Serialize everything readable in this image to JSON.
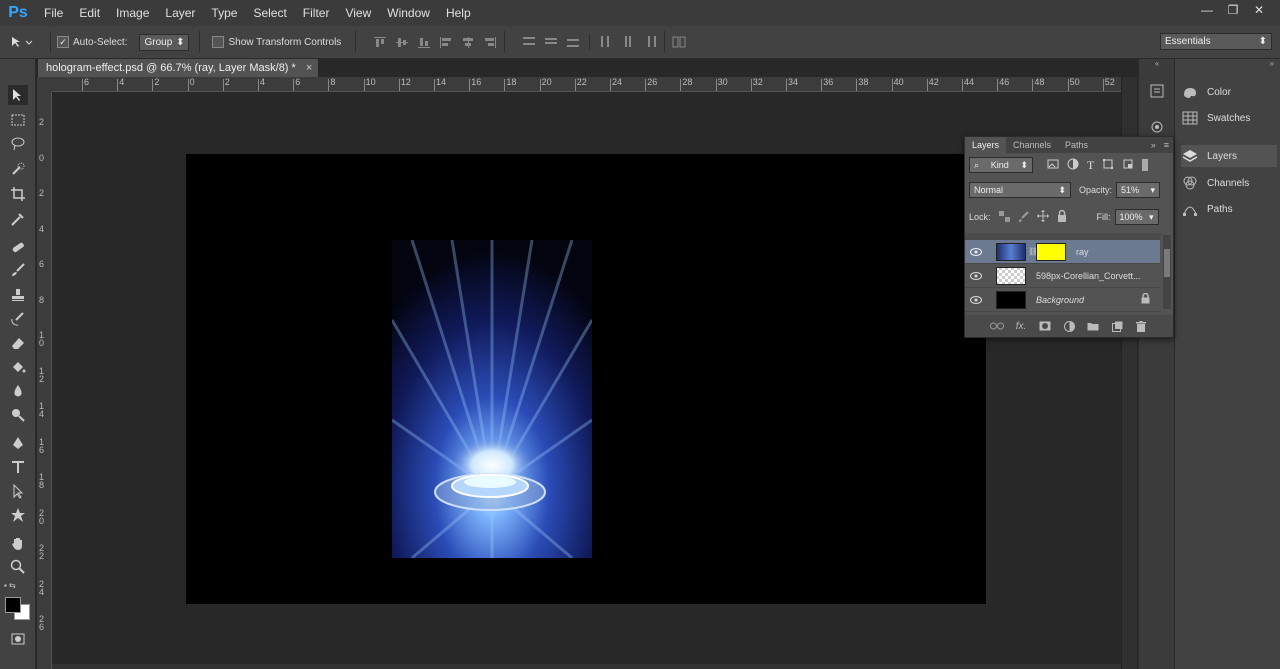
{
  "app": {
    "logo": "Ps"
  },
  "menu": [
    "File",
    "Edit",
    "Image",
    "Layer",
    "Type",
    "Select",
    "Filter",
    "View",
    "Window",
    "Help"
  ],
  "window_controls": {
    "minimize": "—",
    "restore": "❐",
    "close": "✕"
  },
  "options": {
    "auto_select_label": "Auto-Select:",
    "auto_select_checked": true,
    "auto_select_target": "Group",
    "transform_controls_label": "Show Transform Controls",
    "transform_controls_checked": false,
    "workspace": "Essentials"
  },
  "document": {
    "tab_title": "hologram-effect.psd @ 66.7% (ray, Layer Mask/8) *",
    "close_glyph": "×",
    "ruler_top_labels": [
      "6",
      "4",
      "2",
      "0",
      "2",
      "4",
      "6",
      "8",
      "10",
      "12",
      "14",
      "16",
      "18",
      "20",
      "22",
      "24",
      "26",
      "28",
      "30",
      "32",
      "34",
      "36",
      "38",
      "40",
      "42",
      "44",
      "46",
      "48",
      "50",
      "52"
    ],
    "ruler_left_labels": [
      "2",
      "0",
      "2",
      "4",
      "6",
      "8",
      "1 0",
      "1 2",
      "1 4",
      "1 6",
      "1 8",
      "2 0",
      "2 2",
      "2 4",
      "2 6"
    ]
  },
  "panels_collapsed": [
    {
      "label": "Color",
      "icon": "color-icon"
    },
    {
      "label": "Swatches",
      "icon": "swatches-icon"
    },
    {
      "label": "Layers",
      "icon": "layers-icon",
      "active": true
    },
    {
      "label": "Channels",
      "icon": "channels-icon"
    },
    {
      "label": "Paths",
      "icon": "paths-icon"
    }
  ],
  "layers_panel": {
    "tabs": [
      "Layers",
      "Channels",
      "Paths"
    ],
    "active_tab": "Layers",
    "filter_kind": "Kind",
    "blend_mode": "Normal",
    "opacity_label": "Opacity:",
    "opacity_value": "51%",
    "lock_label": "Lock:",
    "fill_label": "Fill:",
    "fill_value": "100%",
    "layers": [
      {
        "name": "ray",
        "selected": true,
        "visible": true,
        "mask_color": "#ffff00"
      },
      {
        "name": "598px-Corellian_Corvett...",
        "selected": false,
        "visible": true
      },
      {
        "name": "Background",
        "selected": false,
        "visible": true,
        "locked": true,
        "italic": true
      }
    ]
  },
  "colors": {
    "foreground": "#000000",
    "background": "#ffffff",
    "accent": "#31a8ff"
  }
}
